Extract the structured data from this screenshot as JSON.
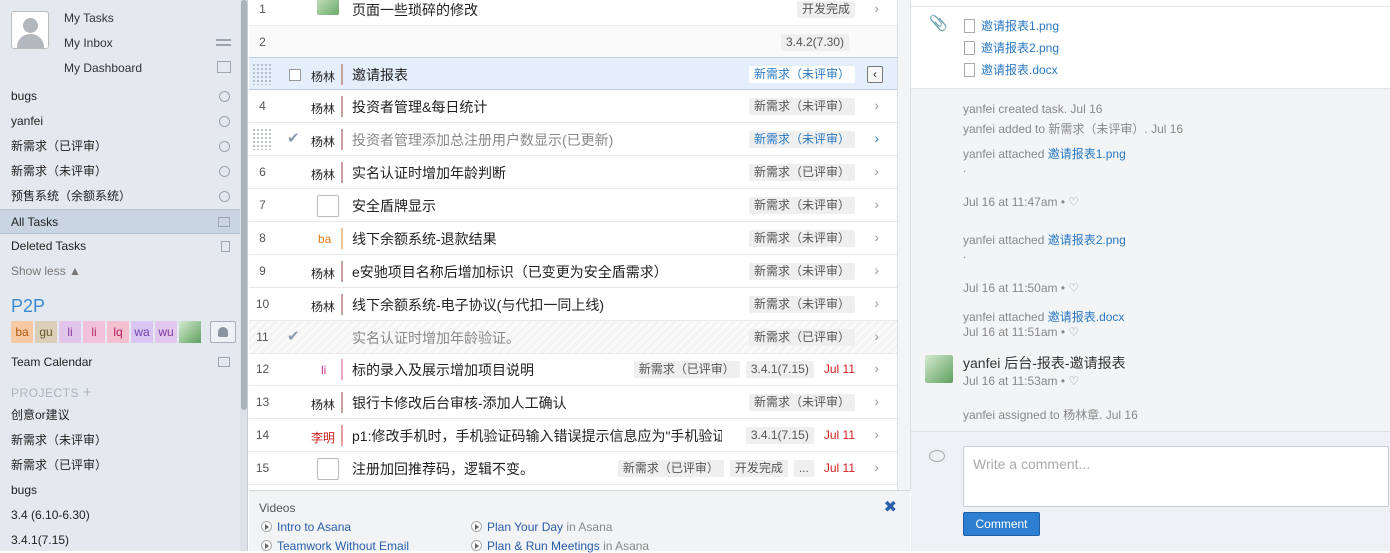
{
  "user": {
    "links": [
      "My Tasks",
      "My Inbox",
      "My Dashboard"
    ]
  },
  "sidebar": {
    "saved": [
      "bugs",
      "yanfei",
      "新需求（已评审）",
      "新需求（未评审）",
      "预售系统（余额系统）"
    ],
    "all_tasks": "All Tasks",
    "deleted": "Deleted Tasks",
    "show_less": "Show less ▲",
    "workspace": "P2P",
    "members": [
      "ba",
      "gu",
      "li",
      "li",
      "lq",
      "wa",
      "wu"
    ],
    "team_calendar": "Team Calendar",
    "projects_header": "PROJECTS",
    "projects": [
      "创意or建议",
      "新需求（未评审）",
      "新需求（已评审）",
      "bugs",
      "3.4 (6.10-6.30)",
      "3.4.1(7.15)"
    ]
  },
  "tasks": [
    {
      "num": "1",
      "assignee": "",
      "title": "页面一些琐碎的修改",
      "tags": [
        "开发完成"
      ],
      "due": ""
    },
    {
      "num": "2",
      "assignee": "",
      "title": "",
      "tags": [
        "3.4.2(7.30)"
      ],
      "due": ""
    },
    {
      "num": "",
      "assignee": "杨林",
      "title": "邀请报表",
      "tags": [
        "新需求（未评审）"
      ],
      "due": ""
    },
    {
      "num": "4",
      "assignee": "杨林",
      "title": "投资者管理&每日统计",
      "tags": [
        "新需求（未评审）"
      ],
      "due": ""
    },
    {
      "num": "",
      "assignee": "杨林",
      "title": "投资者管理添加总注册用户数显示(已更新)",
      "tags": [
        "新需求（未评审）"
      ],
      "due": ""
    },
    {
      "num": "6",
      "assignee": "杨林",
      "title": "实名认证时增加年龄判断",
      "tags": [
        "新需求（已评审）"
      ],
      "due": ""
    },
    {
      "num": "7",
      "assignee": "",
      "title": "安全盾牌显示",
      "tags": [
        "新需求（未评审）"
      ],
      "due": ""
    },
    {
      "num": "8",
      "assignee": "ba",
      "title": "线下余额系统-退款结果",
      "tags": [
        "新需求（未评审）"
      ],
      "due": ""
    },
    {
      "num": "9",
      "assignee": "杨林",
      "title": "e安驰项目名称后增加标识（已变更为安全盾需求）",
      "tags": [
        "新需求（未评审）"
      ],
      "due": ""
    },
    {
      "num": "10",
      "assignee": "杨林",
      "title": "线下余额系统-电子协议(与代扣一同上线)",
      "tags": [
        "新需求（未评审）"
      ],
      "due": ""
    },
    {
      "num": "11",
      "assignee": "",
      "title": "实名认证时增加年龄验证。",
      "tags": [
        "新需求（已评审）"
      ],
      "due": ""
    },
    {
      "num": "12",
      "assignee": "li",
      "title": "标的录入及展示增加项目说明",
      "tags": [
        "新需求（已评审）",
        "3.4.1(7.15)"
      ],
      "due": "Jul 11"
    },
    {
      "num": "13",
      "assignee": "杨林",
      "title": "银行卡修改后台审核-添加人工确认",
      "tags": [
        "新需求（未评审）"
      ],
      "due": ""
    },
    {
      "num": "14",
      "assignee": "李明",
      "title": "p1:修改手机时，手机验证码输入错误提示信息应为\"手机验证",
      "tags": [
        "3.4.1(7.15)"
      ],
      "due": "Jul 11"
    },
    {
      "num": "15",
      "assignee": "",
      "title": "注册加回推荐码，逻辑不变。",
      "tags": [
        "新需求（已评审）",
        "开发完成",
        "..."
      ],
      "due": "Jul 11"
    }
  ],
  "videos": {
    "title": "Videos",
    "close": "✖",
    "items": [
      {
        "label": "Intro to Asana",
        "suffix": ""
      },
      {
        "label": "Teamwork Without Email",
        "suffix": ""
      },
      {
        "label": "Plan Your Day",
        "suffix": " in Asana"
      },
      {
        "label": "Plan & Run Meetings",
        "suffix": " in Asana"
      }
    ]
  },
  "detail": {
    "attachments": [
      "邀请报表1.png",
      "邀请报表2.png",
      "邀请报表.docx"
    ],
    "activity": {
      "created": "yanfei created task.   Jul 16",
      "added": "yanfei added to 新需求（未评审）.   Jul 16",
      "att1_prefix": "yanfei attached ",
      "att1_link": "邀请报表1.png",
      "dot": ".",
      "time1": "Jul 16 at 11:47am  •  ♡",
      "att2_prefix": "yanfei attached ",
      "att2_link": "邀请报表2.png",
      "time2": "Jul 16 at 11:50am  •  ♡",
      "att3_prefix": "yanfei attached ",
      "att3_link": "邀请报表.docx",
      "time3": "Jul 16 at 11:51am  •  ♡",
      "comment": "yanfei 后台-报表-邀请报表",
      "time4": "Jul 16 at 11:53am  •  ♡",
      "assigned": "yanfei assigned to 杨林章.   Jul 16"
    },
    "comment_placeholder": "Write a comment...",
    "comment_button": "Comment"
  },
  "colors": {
    "accent": "#2a79c2",
    "due": "#d02020",
    "selected_row": "#e4effb",
    "sidebar_bg": "#e4e9ef"
  }
}
